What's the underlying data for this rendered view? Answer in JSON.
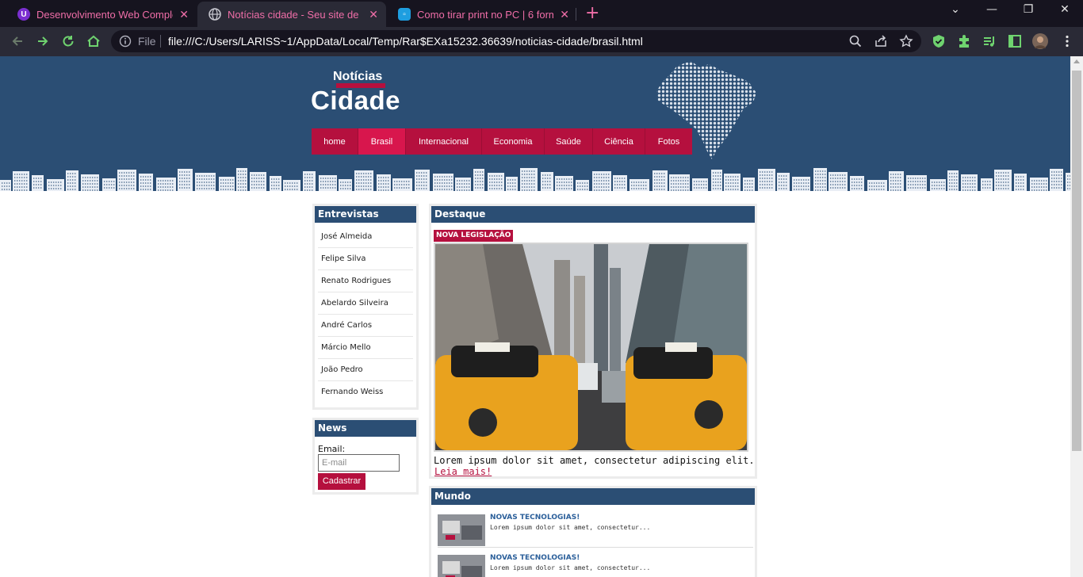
{
  "browser": {
    "tabs": [
      {
        "title": "Desenvolvimento Web Completo",
        "active": false,
        "favicon": "purple-shield-icon"
      },
      {
        "title": "Notícias cidade - Seu site de notícias",
        "active": true,
        "favicon": "globe-icon"
      },
      {
        "title": "Como tirar print no PC | 6 formas",
        "active": false,
        "favicon": "blue-square-icon"
      }
    ],
    "new_tab_label": "+",
    "scheme_label": "File",
    "url": "file:///C:/Users/LARISS~1/AppData/Local/Temp/Rar$EXa15232.36639/noticias-cidade/brasil.html",
    "accent_color": "#f06ea8"
  },
  "site": {
    "logo_small": "Notícias",
    "logo_big": "Cidade",
    "menu": [
      {
        "label": "home",
        "active": false
      },
      {
        "label": "Brasil",
        "active": true
      },
      {
        "label": "Internacional",
        "active": false
      },
      {
        "label": "Economia",
        "active": false
      },
      {
        "label": "Saúde",
        "active": false
      },
      {
        "label": "Ciência",
        "active": false
      },
      {
        "label": "Fotos",
        "active": false
      }
    ],
    "colors": {
      "header_blue": "#2b4e74",
      "brand_red": "#b5103e"
    }
  },
  "interviews": {
    "title": "Entrevistas",
    "items": [
      "José Almeida",
      "Felipe Silva",
      "Renato Rodrigues",
      "Abelardo Silveira",
      "André Carlos",
      "Márcio Mello",
      "João Pedro",
      "Fernando Weiss"
    ]
  },
  "news": {
    "title": "News",
    "email_label": "Email:",
    "email_placeholder": "E-mail",
    "email_value": "",
    "submit_label": "Cadastrar"
  },
  "highlight": {
    "title": "Destaque",
    "tag": "NOVA LEGISLAÇÃO",
    "text": "Lorem ipsum dolor sit amet, consectetur adipiscing elit.",
    "link": "Leia mais!"
  },
  "world": {
    "title": "Mundo",
    "items": [
      {
        "title": "NOVAS TECNOLOGIAS!",
        "text": "Lorem ipsum dolor sit amet, consectetur..."
      },
      {
        "title": "NOVAS TECNOLOGIAS!",
        "text": "Lorem ipsum dolor sit amet, consectetur..."
      }
    ]
  }
}
